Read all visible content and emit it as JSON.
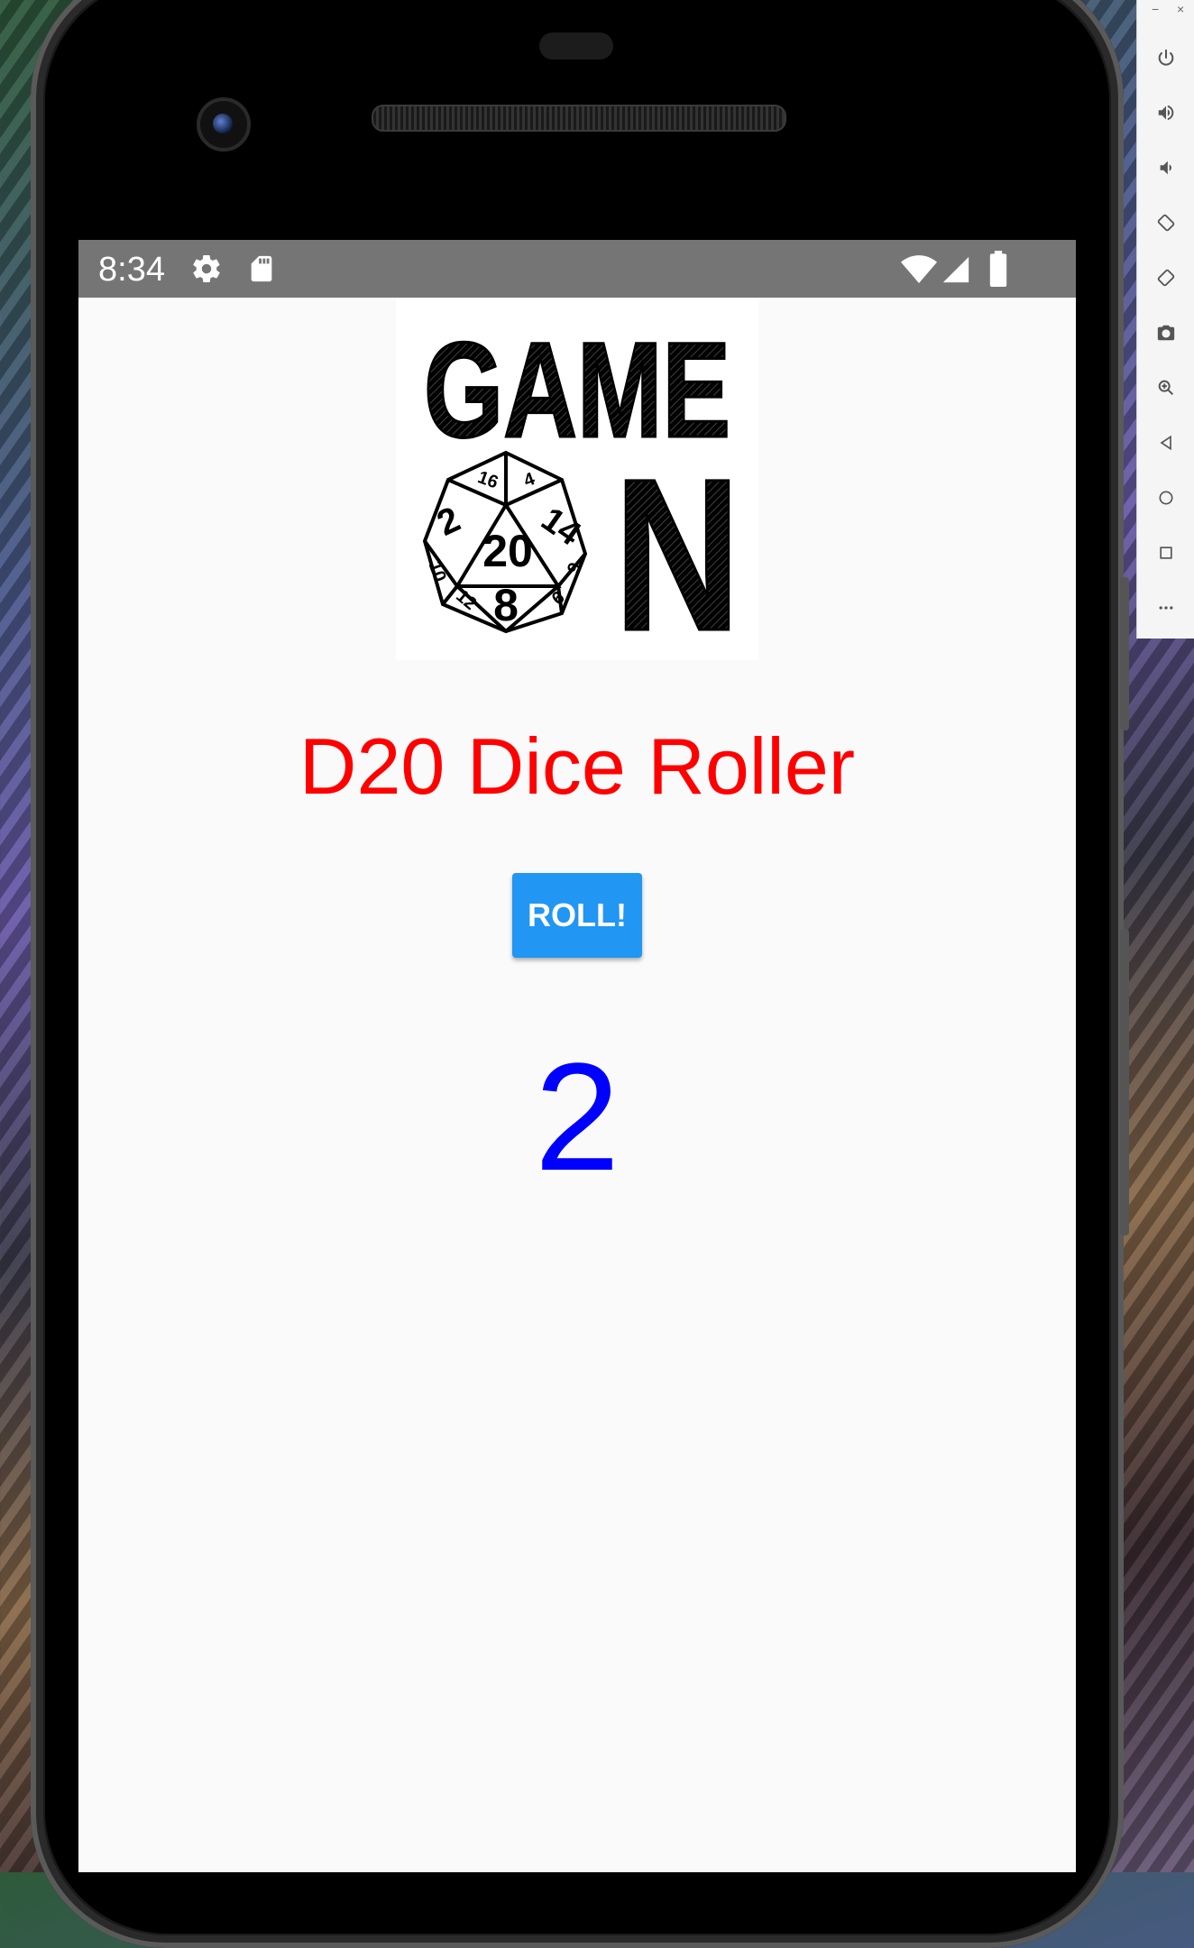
{
  "status_bar": {
    "time": "8:34",
    "icons": [
      "gear-icon",
      "sd-card-icon",
      "wifi-icon",
      "cell-signal-icon",
      "battery-icon"
    ]
  },
  "app": {
    "logo": {
      "word_top": "GAME",
      "word_bottom": "N",
      "die_faces": [
        "2",
        "20",
        "8",
        "14",
        "16",
        "4",
        "10",
        "12",
        "6",
        "9"
      ]
    },
    "title": "D20 Dice Roller",
    "roll_button_label": "ROLL!",
    "result": "2"
  },
  "colors": {
    "title": "#ff0000",
    "button": "#2196f3",
    "result": "#0000ff",
    "status_bar": "#757575",
    "screen_bg": "#fafafa"
  },
  "emulator_toolbar": {
    "window_controls": [
      "−",
      "×"
    ],
    "buttons": [
      "power-icon",
      "volume-up-icon",
      "volume-down-icon",
      "rotate-left-icon",
      "rotate-right-icon",
      "camera-icon",
      "zoom-icon",
      "back-icon",
      "home-icon",
      "overview-icon",
      "more-icon"
    ]
  }
}
